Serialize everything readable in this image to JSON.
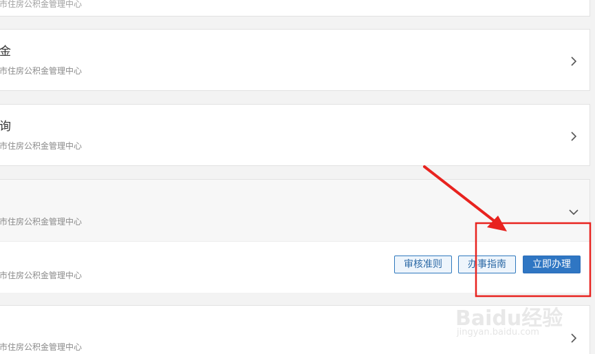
{
  "top_card": {
    "subtitle": "市住房公积金管理中心"
  },
  "items": [
    {
      "title": "金",
      "subtitle": "市住房公积金管理中心",
      "icon": "chevron-right-icon"
    },
    {
      "title": "询",
      "subtitle": "市住房公积金管理中心",
      "icon": "chevron-right-icon"
    },
    {
      "title": "",
      "subtitle": "市住房公积金管理中心",
      "icon": "chevron-down-icon"
    },
    {
      "title": "",
      "subtitle": "市住房公积金管理中心",
      "icon": "chevron-right-icon"
    }
  ],
  "expanded_detail": {
    "subtitle": "市住房公积金管理中心",
    "buttons": {
      "review_rules": "审核准则",
      "guide": "办事指南",
      "apply_now": "立即办理"
    }
  },
  "watermark": {
    "main": "Baidu经验",
    "sub": "jingyan.baidu.com"
  },
  "colors": {
    "accent": "#2f76c3",
    "annotation_red": "#e8231f",
    "background": "#f3f3f3"
  }
}
